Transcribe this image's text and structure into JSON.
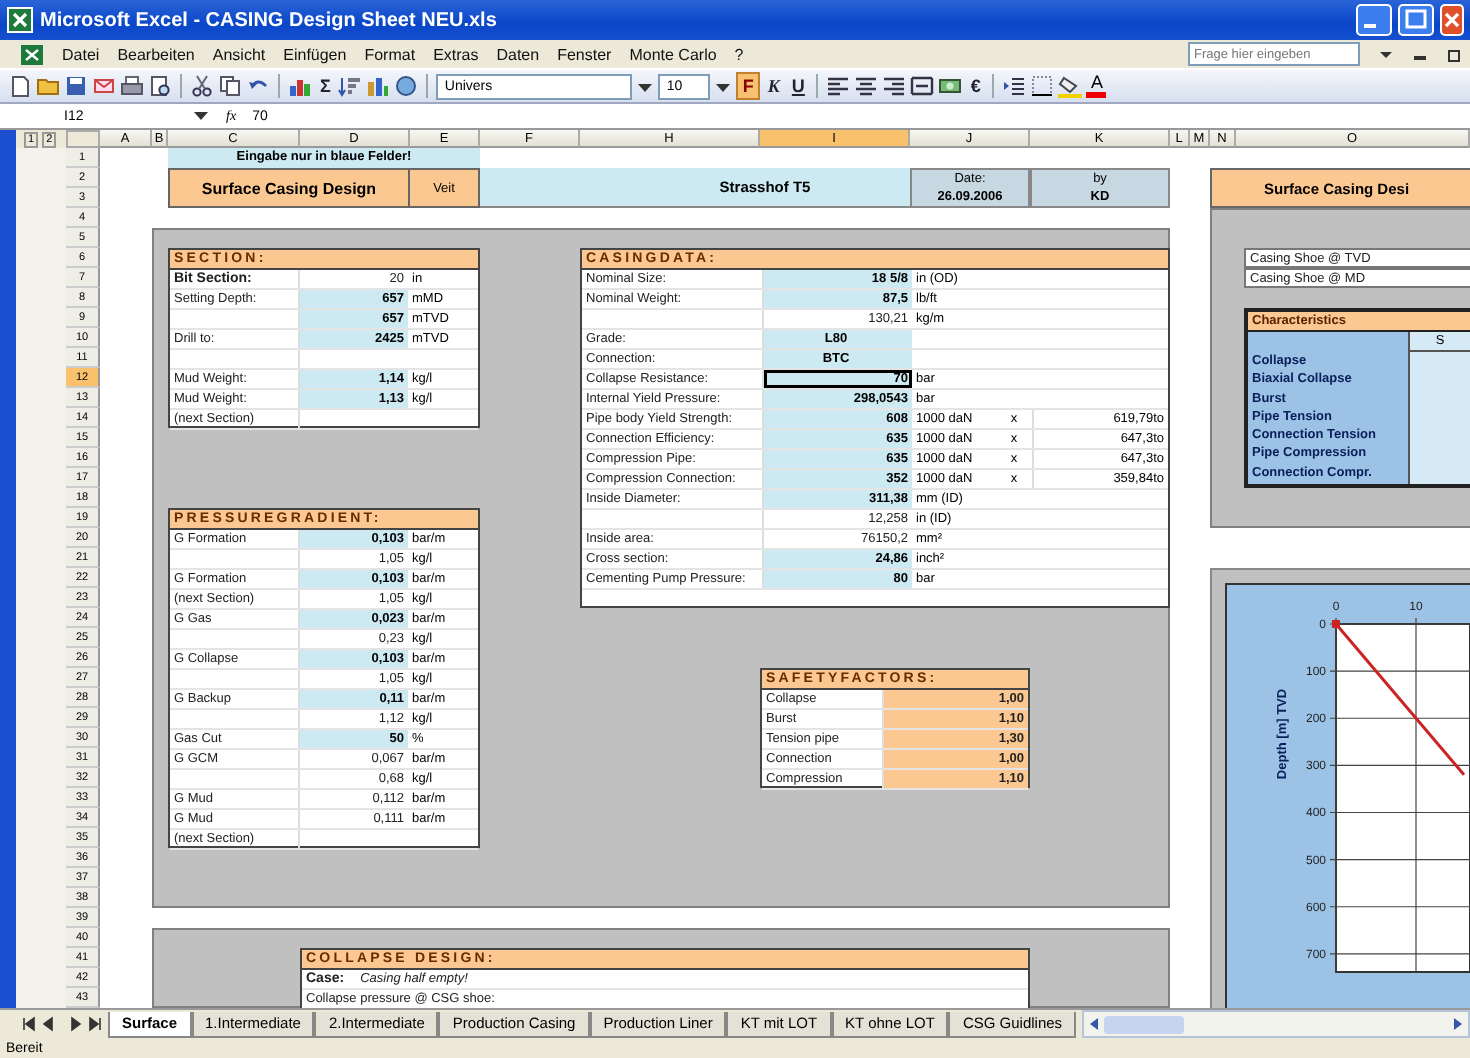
{
  "window": {
    "title": "Microsoft Excel - CASING Design Sheet NEU.xls"
  },
  "menu": [
    "Datei",
    "Bearbeiten",
    "Ansicht",
    "Einfügen",
    "Format",
    "Extras",
    "Daten",
    "Fenster",
    "Monte Carlo",
    "?"
  ],
  "help_field": {
    "placeholder": "Frage hier eingeben"
  },
  "toolbar": {
    "sum": "Σ",
    "font": "Univers",
    "size": "10",
    "bold": "F",
    "italic": "K",
    "underline": "U",
    "euro": "€",
    "font_color": "A"
  },
  "formula_bar": {
    "name_box": "I12",
    "fx": "fx",
    "value": "70"
  },
  "outline_levels": [
    "1",
    "2"
  ],
  "columns": [
    {
      "label": "A",
      "selected": false
    },
    {
      "label": "B",
      "selected": false
    },
    {
      "label": "C",
      "selected": false
    },
    {
      "label": "D",
      "selected": false
    },
    {
      "label": "E",
      "selected": false
    },
    {
      "label": "F",
      "selected": false
    },
    {
      "label": "H",
      "selected": false
    },
    {
      "label": "I",
      "selected": true
    },
    {
      "label": "J",
      "selected": false
    },
    {
      "label": "K",
      "selected": false
    },
    {
      "label": "L",
      "selected": false
    },
    {
      "label": "M",
      "selected": false
    },
    {
      "label": "N",
      "selected": false
    },
    {
      "label": "O",
      "selected": false
    }
  ],
  "rows": [
    {
      "label": "1",
      "selected": false
    },
    {
      "label": "2",
      "selected": false
    },
    {
      "label": "3",
      "selected": false
    },
    {
      "label": "4",
      "selected": false
    },
    {
      "label": "5",
      "selected": false
    },
    {
      "label": "6",
      "selected": false
    },
    {
      "label": "7",
      "selected": false
    },
    {
      "label": "8",
      "selected": false
    },
    {
      "label": "9",
      "selected": false
    },
    {
      "label": "10",
      "selected": false
    },
    {
      "label": "11",
      "selected": false
    },
    {
      "label": "12",
      "selected": true
    },
    {
      "label": "13",
      "selected": false
    },
    {
      "label": "14",
      "selected": false
    },
    {
      "label": "15",
      "selected": false
    },
    {
      "label": "16",
      "selected": false
    },
    {
      "label": "17",
      "selected": false
    },
    {
      "label": "18",
      "selected": false
    },
    {
      "label": "19",
      "selected": false
    },
    {
      "label": "20",
      "selected": false
    },
    {
      "label": "21",
      "selected": false
    },
    {
      "label": "22",
      "selected": false
    },
    {
      "label": "23",
      "selected": false
    },
    {
      "label": "24",
      "selected": false
    },
    {
      "label": "25",
      "selected": false
    },
    {
      "label": "26",
      "selected": false
    },
    {
      "label": "27",
      "selected": false
    },
    {
      "label": "28",
      "selected": false
    },
    {
      "label": "29",
      "selected": false
    },
    {
      "label": "30",
      "selected": false
    },
    {
      "label": "31",
      "selected": false
    },
    {
      "label": "32",
      "selected": false
    },
    {
      "label": "33",
      "selected": false
    },
    {
      "label": "34",
      "selected": false
    },
    {
      "label": "35",
      "selected": false
    },
    {
      "label": "36",
      "selected": false
    },
    {
      "label": "37",
      "selected": false
    },
    {
      "label": "38",
      "selected": false
    },
    {
      "label": "39",
      "selected": false
    },
    {
      "label": "40",
      "selected": false
    },
    {
      "label": "41",
      "selected": false
    },
    {
      "label": "42",
      "selected": false
    },
    {
      "label": "43",
      "selected": false
    }
  ],
  "header": {
    "note": "Eingabe nur in blaue Felder!",
    "title": "Surface Casing Design",
    "version": "Veit",
    "well": "Strasshof T5",
    "date_label": "Date:",
    "date": "26.09.2006",
    "by_label": "by",
    "by": "KD"
  },
  "section": {
    "title": "SECTION:",
    "rows": [
      {
        "kind": "heading",
        "label": "Bit Section:",
        "value": "20",
        "unit": "in",
        "input": false
      },
      {
        "kind": "plain",
        "label": "Setting Depth:",
        "value": "657",
        "unit": "mMD",
        "input": true
      },
      {
        "kind": "plain",
        "value": "657",
        "unit": "mTVD",
        "input": true
      },
      {
        "kind": "plain",
        "label": "Drill to:",
        "value": "2425",
        "unit": "mTVD",
        "input": true
      },
      {
        "kind": "plain"
      },
      {
        "kind": "plain",
        "label": "Mud Weight:",
        "value": "1,14",
        "unit": "kg/l",
        "input": true
      },
      {
        "kind": "plain",
        "label": "Mud Weight:",
        "value": "1,13",
        "unit": "kg/l",
        "input": true
      },
      {
        "kind": "plain",
        "label": "(next Section)"
      }
    ]
  },
  "pressure_gradient": {
    "title": "PRESSUREGRADIENT:",
    "rows": [
      {
        "label": "G Formation",
        "value": "0,103",
        "unit": "bar/m",
        "input": true
      },
      {
        "value": "1,05",
        "unit": "kg/l",
        "input": false
      },
      {
        "label": "G Formation",
        "value": "0,103",
        "unit": "bar/m",
        "input": true
      },
      {
        "label": "(next Section)",
        "value": "1,05",
        "unit": "kg/l",
        "input": false
      },
      {
        "label": "G Gas",
        "value": "0,023",
        "unit": "bar/m",
        "input": true
      },
      {
        "value": "0,23",
        "unit": "kg/l",
        "input": false
      },
      {
        "label": "G Collapse",
        "value": "0,103",
        "unit": "bar/m",
        "input": true
      },
      {
        "value": "1,05",
        "unit": "kg/l",
        "input": false
      },
      {
        "label": "G Backup",
        "value": "0,11",
        "unit": "bar/m",
        "input": true
      },
      {
        "value": "1,12",
        "unit": "kg/l",
        "input": false
      },
      {
        "label": "Gas Cut",
        "value": "50",
        "unit": "%",
        "input": true
      },
      {
        "label": "G GCM",
        "value": "0,067",
        "unit": "bar/m",
        "input": false
      },
      {
        "value": "0,68",
        "unit": "kg/l",
        "input": false
      },
      {
        "label": "G Mud",
        "value": "0,112",
        "unit": "bar/m",
        "input": false
      },
      {
        "label": "G Mud",
        "value": "0,111",
        "unit": "bar/m",
        "input": false
      },
      {
        "label": "(next Section)"
      }
    ]
  },
  "casing_data": {
    "title": "CASINGDATA:",
    "rows": [
      {
        "label": "Nominal Size:",
        "value": "18 5/8",
        "unit": "in (OD)",
        "input": true,
        "active": false
      },
      {
        "label": "Nominal Weight:",
        "value": "87,5",
        "unit": "lb/ft",
        "input": true,
        "active": false
      },
      {
        "value": "130,21",
        "unit": "kg/m",
        "input": false,
        "active": false
      },
      {
        "label": "Grade:",
        "value": "L80",
        "input": true,
        "active": false
      },
      {
        "label": "Connection:",
        "value": "BTC",
        "input": true,
        "active": false
      },
      {
        "label": "Collapse Resistance:",
        "value": "70",
        "unit": "bar",
        "input": true,
        "active": true
      },
      {
        "label": "Internal Yield Pressure:",
        "value": "298,0543",
        "unit": "bar",
        "input": true,
        "active": false
      },
      {
        "label": "Pipe body Yield Strength:",
        "value": "608",
        "unit": "1000 daN",
        "times": "x",
        "converted": "619,79to",
        "input": true,
        "active": false
      },
      {
        "label": "Connection Efficiency:",
        "value": "635",
        "unit": "1000 daN",
        "times": "x",
        "converted": "647,3to",
        "input": true,
        "active": false
      },
      {
        "label": "Compression Pipe:",
        "value": "635",
        "unit": "1000 daN",
        "times": "x",
        "converted": "647,3to",
        "input": true,
        "active": false
      },
      {
        "label": "Compression Connection:",
        "value": "352",
        "unit": "1000 daN",
        "times": "x",
        "converted": "359,84to",
        "input": true,
        "active": false
      },
      {
        "label": "Inside Diameter:",
        "value": "311,38",
        "unit": "mm (ID)",
        "input": true,
        "active": false
      },
      {
        "value": "12,258",
        "unit": "in (ID)",
        "input": false,
        "active": false
      },
      {
        "label": "Inside area:",
        "value": "76150,2",
        "unit": "mm²",
        "input": false,
        "active": false
      },
      {
        "label": "Cross section:",
        "value": "24,86",
        "unit": "inch²",
        "input": true,
        "active": false
      },
      {
        "label": "Cementing Pump Pressure:",
        "value": "80",
        "unit": "bar",
        "input": true,
        "active": false
      }
    ]
  },
  "safety_factors": {
    "title": "SAFETYFACTORS:",
    "rows": [
      {
        "label": "Collapse",
        "value": "1,00"
      },
      {
        "label": "Burst",
        "value": "1,10"
      },
      {
        "label": "Tension pipe",
        "value": "1,30"
      },
      {
        "label": "Connection",
        "value": "1,00"
      },
      {
        "label": "Compression",
        "value": "1,10"
      }
    ]
  },
  "collapse_design": {
    "title": "COLLAPSE DESIGN:",
    "case_label": "Case:",
    "case": "Casing half empty!",
    "row": "Collapse pressure @ CSG shoe:"
  },
  "summary": {
    "title": "Surface Casing Desi",
    "shoe_rows": [
      "Casing Shoe @ TVD",
      "Casing Shoe @ MD"
    ],
    "characteristics": {
      "title": "Characteristics",
      "column_1": "S",
      "items": [
        "Collapse",
        "Biaxial Collapse",
        "Burst",
        "Pipe Tension",
        "Connection Tension",
        "Pipe Compression",
        "Connection Compr."
      ]
    }
  },
  "chart": {
    "chart_data": {
      "type": "line",
      "ylabel": "Depth [m] TVD",
      "x": [
        0,
        16
      ],
      "series": [
        {
          "color": "#cc2222",
          "values": [
            0,
            320
          ]
        }
      ],
      "grid": true,
      "xlim": [
        0,
        16.75
      ],
      "ylim": [
        730,
        0
      ],
      "xticks": [
        0,
        10
      ],
      "yticks": [
        0,
        100,
        200,
        300,
        400,
        500,
        600,
        700
      ]
    }
  },
  "sheet_tabs": [
    {
      "label": "Surface",
      "selected": true
    },
    {
      "label": "1.Intermediate",
      "selected": false
    },
    {
      "label": "2.Intermediate",
      "selected": false
    },
    {
      "label": "Production Casing",
      "selected": false
    },
    {
      "label": "Production Liner",
      "selected": false
    },
    {
      "label": "KT mit LOT",
      "selected": false
    },
    {
      "label": "KT ohne LOT",
      "selected": false
    },
    {
      "label": "CSG Guidlines",
      "selected": false
    }
  ],
  "status_bar": {
    "text": "Bereit"
  }
}
